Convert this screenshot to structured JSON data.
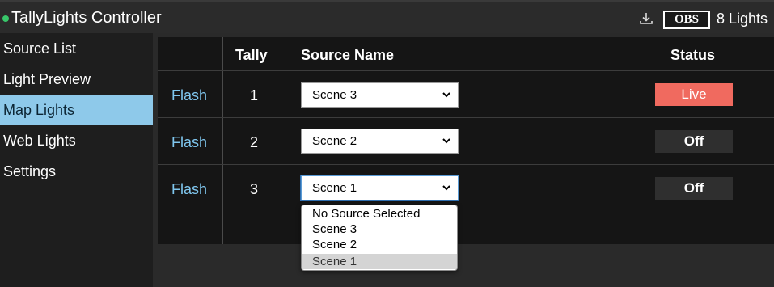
{
  "header": {
    "title": "TallyLights Controller",
    "status_dot_color": "#38c76a",
    "download_icon": "download-icon",
    "badge": "OBS",
    "lights_count": "8 Lights"
  },
  "sidebar": {
    "items": [
      {
        "label": "Source List",
        "active": false
      },
      {
        "label": "Light Preview",
        "active": false
      },
      {
        "label": "Map Lights",
        "active": true
      },
      {
        "label": "Web Lights",
        "active": false
      },
      {
        "label": "Settings",
        "active": false
      }
    ],
    "active_color": "#8ec9ea"
  },
  "table": {
    "headers": {
      "tally": "Tally",
      "source": "Source Name",
      "status": "Status"
    },
    "rows": [
      {
        "action": "Flash",
        "tally": "1",
        "source": "Scene 3",
        "status": "Live"
      },
      {
        "action": "Flash",
        "tally": "2",
        "source": "Scene 2",
        "status": "Off"
      },
      {
        "action": "Flash",
        "tally": "3",
        "source": "Scene 1",
        "status": "Off"
      }
    ],
    "live_color": "#f06a5f",
    "link_color": "#7fc6ee"
  },
  "dropdown": {
    "options": [
      "No Source Selected",
      "Scene 3",
      "Scene 2",
      "Scene 1"
    ],
    "selected": "Scene 1"
  }
}
